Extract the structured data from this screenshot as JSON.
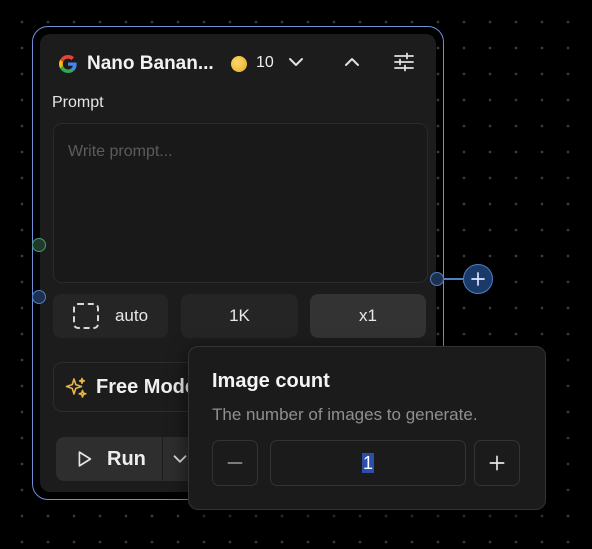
{
  "node": {
    "model_name": "Nano Banan...",
    "credits": "10",
    "prompt_label": "Prompt",
    "prompt_placeholder": "Write prompt...",
    "aspect_label": "auto",
    "resolution_label": "1K",
    "count_label": "x1",
    "mode_label": "Free Mode",
    "run_label": "Run"
  },
  "popover": {
    "title": "Image count",
    "description": "The number of images to generate.",
    "value": "1"
  },
  "colors": {
    "node_border": "#6f8fd6",
    "handle_green": "#4a9b6b",
    "handle_blue": "#4f7fc4",
    "coin": "#f0b63a",
    "sparkle": "#e6b54a"
  },
  "icons": [
    "google-icon",
    "coin-icon",
    "chevron-down-icon",
    "chevron-up-icon",
    "sliders-icon",
    "dashed-square-icon",
    "sparkle-icon",
    "play-icon",
    "chevron-down-icon",
    "plus-icon",
    "minus-icon"
  ]
}
